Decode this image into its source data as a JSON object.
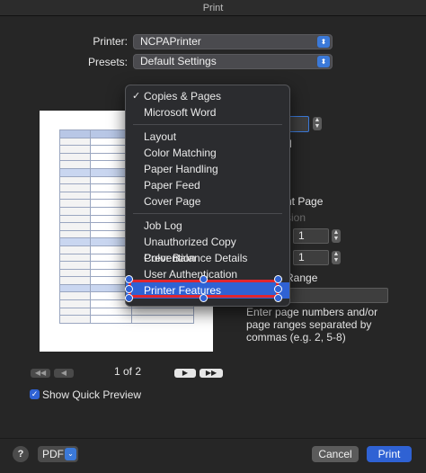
{
  "window": {
    "title": "Print"
  },
  "printer": {
    "label": "Printer:",
    "value": "NCPAPrinter"
  },
  "presets": {
    "label": "Presets:",
    "value": "Default Settings"
  },
  "menu": {
    "items": [
      {
        "label": "Copies & Pages",
        "checked": true
      },
      {
        "label": "Microsoft Word"
      },
      {
        "label": "Layout"
      },
      {
        "label": "Color Matching"
      },
      {
        "label": "Paper Handling"
      },
      {
        "label": "Paper Feed"
      },
      {
        "label": "Cover Page"
      },
      {
        "label": "Job Log"
      },
      {
        "label": "Unauthorized Copy Prevention"
      },
      {
        "label": "Color Balance Details"
      },
      {
        "label": "User Authentication"
      },
      {
        "label": "Printer Features",
        "selected": true
      }
    ],
    "check_glyph": "✓"
  },
  "right_panel": {
    "text_d": "d",
    "text_page": "nt Page",
    "text_sion": "sion",
    "field1_value": "1",
    "field2_value": "1",
    "text_range": "Range",
    "help_text": "Enter page numbers and/or page ranges separated by commas (e.g. 2, 5-8)"
  },
  "pager": {
    "text": "1 of 2",
    "first": "◀◀",
    "prev": "◀",
    "next": "▶",
    "last": "▶▶"
  },
  "quick_preview": {
    "label": "Show Quick Preview",
    "checked": true,
    "check_glyph": "✓"
  },
  "footer": {
    "help": "?",
    "pdf": "PDF",
    "pdf_chevron": "⌄",
    "cancel": "Cancel",
    "print": "Print"
  },
  "colors": {
    "accent": "#2f62d4",
    "highlight_border": "#e0262e"
  }
}
